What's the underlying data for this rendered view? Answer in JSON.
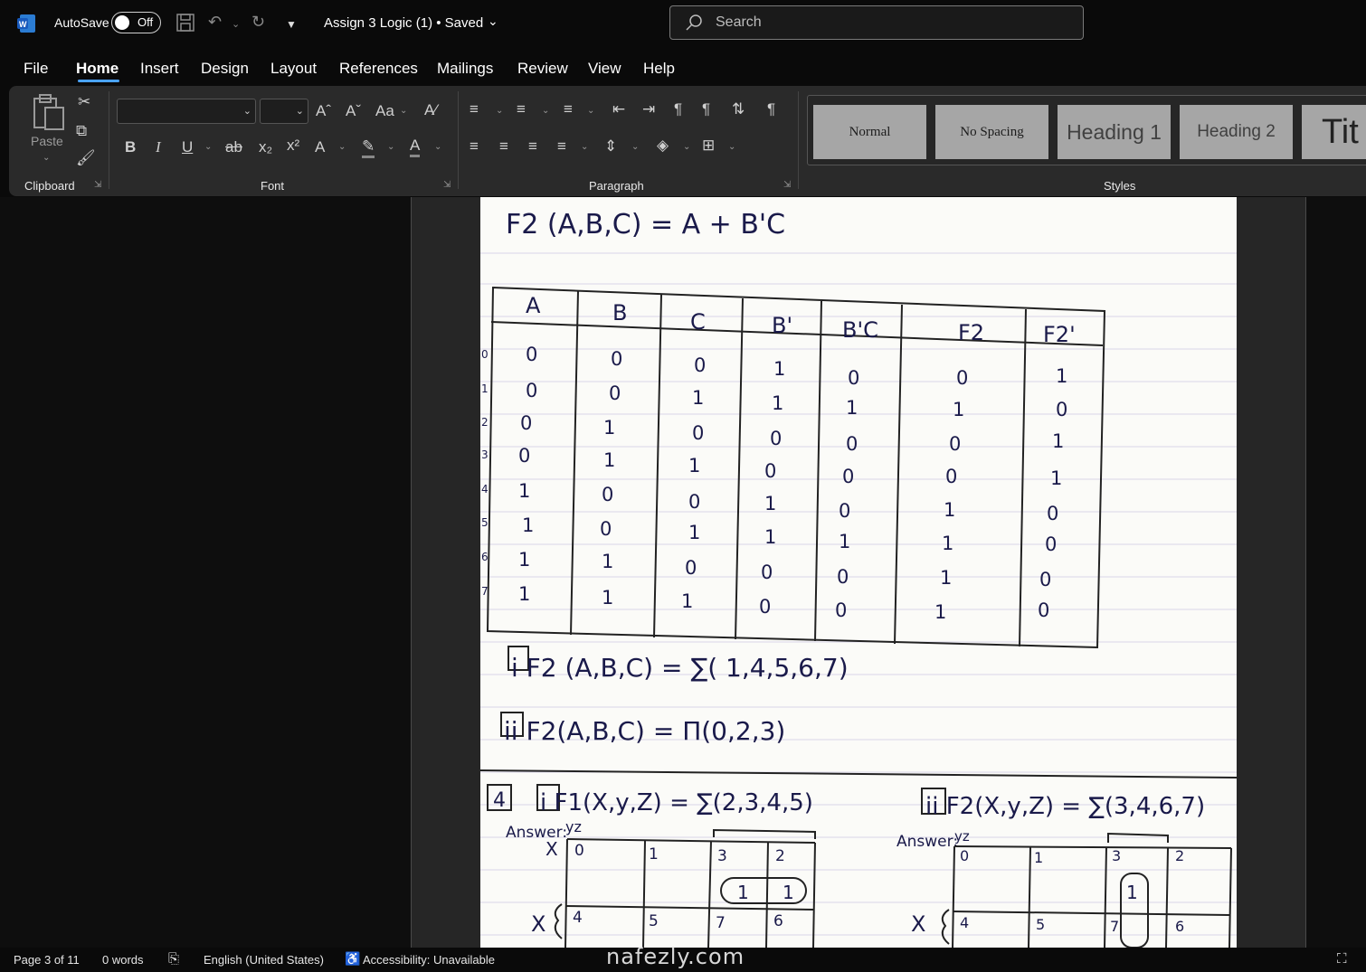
{
  "titlebar": {
    "autosave_label": "AutoSave",
    "autosave_state": "Off",
    "document_title": "Assign 3 Logic (1)  •  Saved",
    "search_placeholder": "Search"
  },
  "menu": [
    "File",
    "Home",
    "Insert",
    "Design",
    "Layout",
    "References",
    "Mailings",
    "Review",
    "View",
    "Help"
  ],
  "ribbon": {
    "clipboard": {
      "paste_label": "Paste",
      "group_label": "Clipboard"
    },
    "font": {
      "group_label": "Font",
      "font_name": "",
      "font_size": ""
    },
    "paragraph": {
      "group_label": "Paragraph"
    },
    "styles": {
      "group_label": "Styles",
      "items": [
        "Normal",
        "No Spacing",
        "Heading 1",
        "Heading 2",
        "Tit"
      ]
    }
  },
  "document": {
    "line1": "F2 (A,B,C) = A + B'C",
    "table_headers": [
      "A",
      "B",
      "C",
      "B'",
      "B'C",
      "F2",
      "F2'"
    ],
    "row_indices": [
      "0",
      "1",
      "2",
      "3",
      "4",
      "5",
      "6",
      "7"
    ],
    "table_rows": [
      [
        "0",
        "0",
        "0",
        "1",
        "0",
        "0",
        "1"
      ],
      [
        "0",
        "0",
        "1",
        "1",
        "1",
        "1",
        "0"
      ],
      [
        "0",
        "1",
        "0",
        "0",
        "0",
        "0",
        "1"
      ],
      [
        "0",
        "1",
        "1",
        "0",
        "0",
        "0",
        "1"
      ],
      [
        "1",
        "0",
        "0",
        "1",
        "0",
        "1",
        "0"
      ],
      [
        "1",
        "0",
        "1",
        "1",
        "1",
        "1",
        "0"
      ],
      [
        "1",
        "1",
        "0",
        "0",
        "0",
        "1",
        "0"
      ],
      [
        "1",
        "1",
        "1",
        "0",
        "0",
        "1",
        "0"
      ]
    ],
    "line_i": "i  F2 (A,B,C) = ∑( 1,4,5,6,7)",
    "line_ii": "ii  F2(A,B,C) = Π(0,2,3)",
    "q4_label": "4",
    "q4_i": "i  F1(X,y,Z) = ∑(2,3,4,5)",
    "q4_ii": "ii  F2(X,y,Z) = ∑(3,4,6,7)",
    "answer_label": "Answer:",
    "kmap_yz_label": "yz",
    "kmap_x_label": "X",
    "kmap1": {
      "top_cells": [
        "0",
        "1",
        "3",
        "2"
      ],
      "bottom_cells": [
        "4",
        "5",
        "7",
        "6"
      ],
      "ones": [
        "1",
        "1"
      ]
    },
    "kmap2": {
      "top_cells": [
        "0",
        "1",
        "3",
        "2"
      ],
      "bottom_cells": [
        "4",
        "5",
        "7",
        "6"
      ],
      "ones": [
        "1"
      ]
    }
  },
  "statusbar": {
    "page": "Page 3 of 11",
    "words": "0 words",
    "language": "English (United States)",
    "accessibility": "Accessibility: Unavailable"
  },
  "watermark": "nafezly.com",
  "colors": {
    "accent": "#4aa3ff",
    "ribbon_bg": "#2a2a2a",
    "style_tile": "#a6a6a6",
    "ink": "#1a1a4a"
  }
}
